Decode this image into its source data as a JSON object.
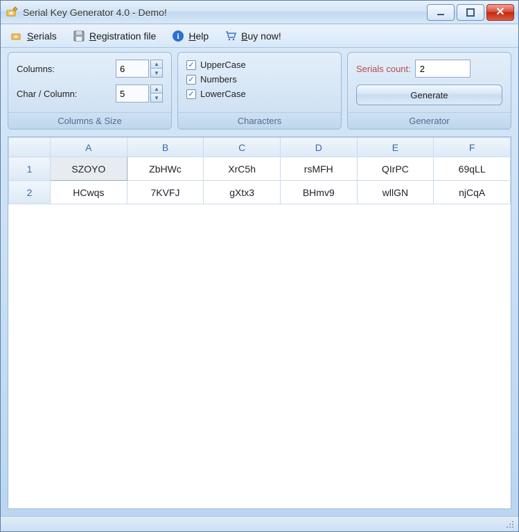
{
  "window": {
    "title": "Serial Key Generator 4.0 - Demo!"
  },
  "menu": {
    "serials": "Serials",
    "registration": "Registration file",
    "help": "Help",
    "buy": "Buy now!"
  },
  "groups": {
    "columns_size": {
      "label": "Columns & Size",
      "columns_label": "Columns:",
      "columns_value": "6",
      "charcol_label": "Char / Column:",
      "charcol_value": "5"
    },
    "characters": {
      "label": "Characters",
      "uppercase": "UpperCase",
      "numbers": "Numbers",
      "lowercase": "LowerCase"
    },
    "generator": {
      "label": "Generator",
      "count_label": "Serials count:",
      "count_value": "2",
      "button": "Generate"
    }
  },
  "table": {
    "headers": [
      "A",
      "B",
      "C",
      "D",
      "E",
      "F"
    ],
    "rows": [
      {
        "n": "1",
        "cells": [
          "SZOYO",
          "ZbHWc",
          "XrC5h",
          "rsMFH",
          "QIrPC",
          "69qLL"
        ]
      },
      {
        "n": "2",
        "cells": [
          "HCwqs",
          "7KVFJ",
          "gXtx3",
          "BHmv9",
          "wllGN",
          "njCqA"
        ]
      }
    ]
  }
}
